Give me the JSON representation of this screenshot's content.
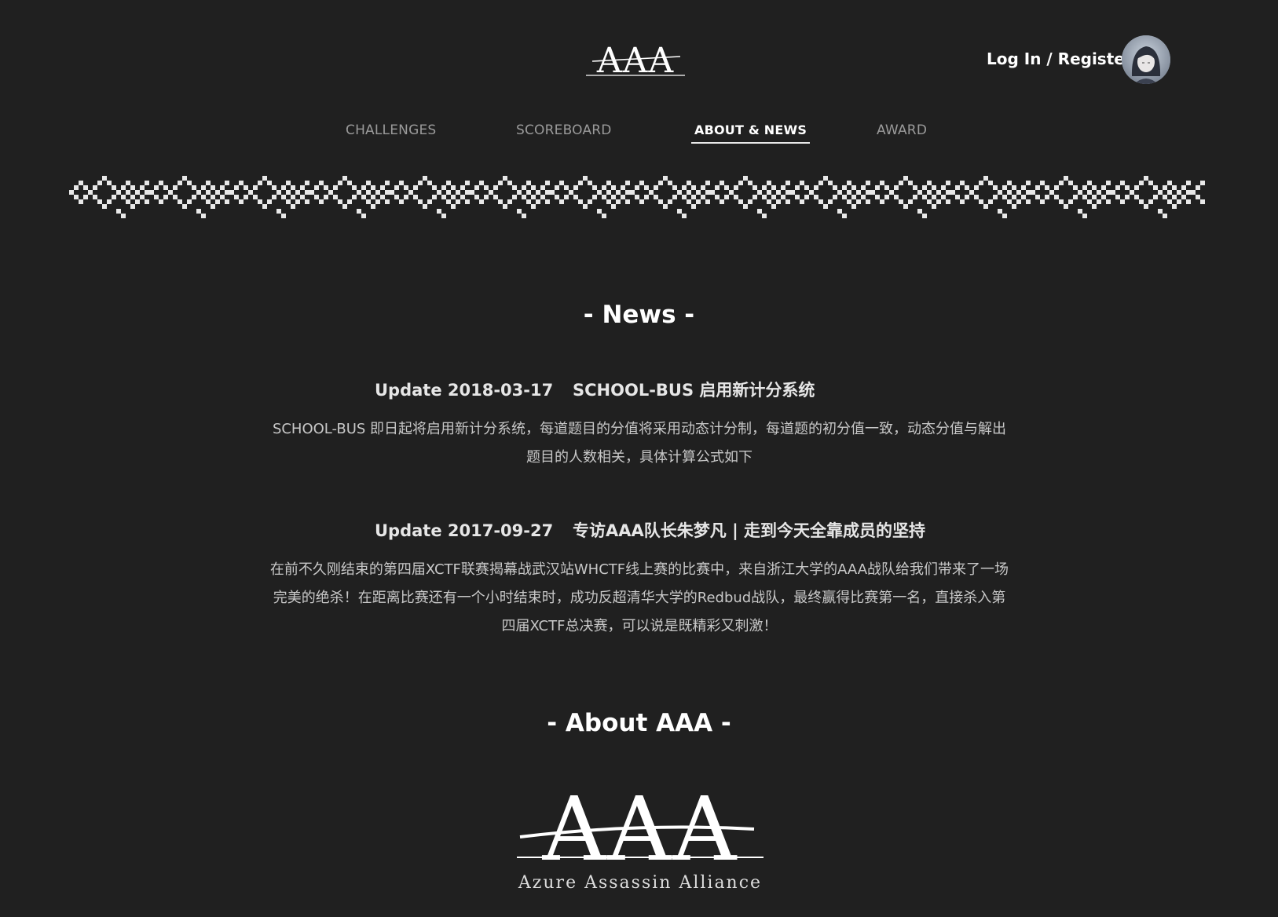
{
  "header": {
    "logo_text": "AAA",
    "account_link": "Log In / Register"
  },
  "nav": {
    "items": [
      {
        "label": "CHALLENGES",
        "active": false
      },
      {
        "label": "SCOREBOARD",
        "active": false
      },
      {
        "label": "ABOUT & NEWS",
        "active": true
      },
      {
        "label": "AWARD",
        "active": false
      }
    ]
  },
  "news": {
    "heading": "- News -",
    "items": [
      {
        "date": "Update 2018-03-17",
        "title": "SCHOOL-BUS 启用新计分系统",
        "body": "SCHOOL-BUS 即日起将启用新计分系统，每道题目的分值将采用动态计分制，每道题的初分值一致，动态分值与解出题目的人数相关，具体计算公式如下"
      },
      {
        "date": "Update 2017-09-27",
        "title": "专访AAA队长朱梦凡 | 走到今天全靠成员的坚持",
        "body": "在前不久刚结束的第四届XCTF联赛揭幕战武汉站WHCTF线上赛的比赛中，来自浙江大学的AAA战队给我们带来了一场完美的绝杀！在距离比赛还有一个小时结束时，成功反超清华大学的Redbud战队，最终赢得比赛第一名，直接杀入第四届XCTF总决赛，可以说是既精彩又刺激！"
      }
    ]
  },
  "about": {
    "heading": "- About AAA -",
    "logo_text": "AAA",
    "logo_subtitle": "Azure Assassin Alliance"
  },
  "colors": {
    "background": "#202020",
    "text": "#d8d8d8",
    "accent": "#ffffff",
    "nav_inactive": "#9a9a9a"
  },
  "icons": {
    "avatar": "user-avatar-icon",
    "banner": "pixel-pattern-banner"
  }
}
